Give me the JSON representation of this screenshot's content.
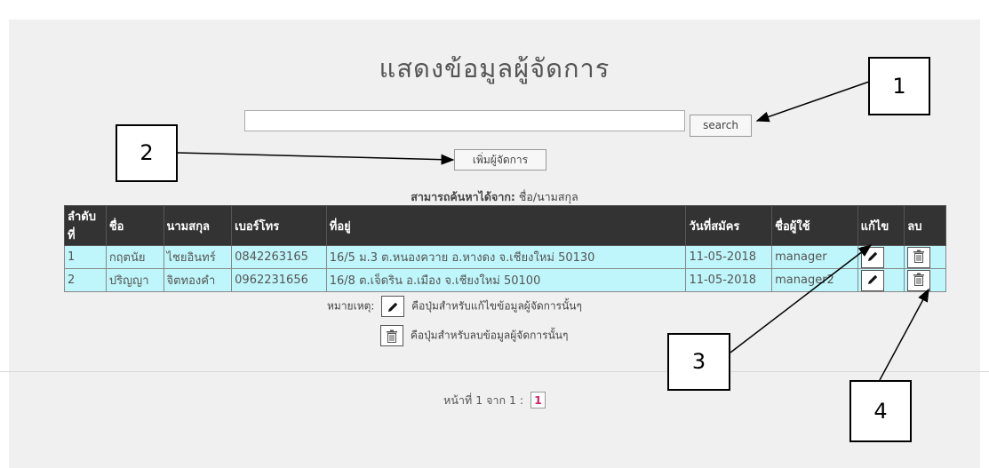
{
  "page": {
    "title": "แสดงข้อมูลผู้จัดการ",
    "search": {
      "value": "",
      "button_label": "search"
    },
    "add_button_label": "เพิ่มผู้จัดการ",
    "hint_prefix": "สามารถค้นหาได้จาก:",
    "hint_value": "ชื่อ/นามสกุล"
  },
  "table": {
    "headers": [
      "ลำดับที่",
      "ชื่อ",
      "นามสกุล",
      "เบอร์โทร",
      "ที่อยู่",
      "วันที่สมัคร",
      "ชื่อผู้ใช้",
      "แก้ไข",
      "ลบ"
    ],
    "rows": [
      {
        "no": "1",
        "first": "กฤตนัย",
        "last": "ไชยอินทร์",
        "phone": "0842263165",
        "address": "16/5 ม.3 ต.หนองควาย อ.หางดง จ.เชียงใหม่ 50130",
        "date": "11-05-2018",
        "username": "manager"
      },
      {
        "no": "2",
        "first": "ปริญญา",
        "last": "จิตทองคำ",
        "phone": "0962231656",
        "address": "16/8 ต.เจ็ดริน อ.เมือง จ.เชียงใหม่ 50100",
        "date": "11-05-2018",
        "username": "manager2"
      }
    ]
  },
  "notes": {
    "prefix": "หมายเหตุ:",
    "edit_note": "คือปุ่มสำหรับแก้ไขข้อมูลผู้จัดการนั้นๆ",
    "delete_note": "คือปุ่มสำหรับลบข้อมูลผู้จัดการนั้นๆ"
  },
  "pager": {
    "label": "หน้าที่ 1 จาก 1 :",
    "current": "1"
  },
  "callouts": [
    "1",
    "2",
    "3",
    "4"
  ],
  "icons": {
    "edit": "pencil-icon",
    "delete": "trash-icon"
  },
  "colors": {
    "header_bg": "#333333",
    "row_bg": "#bff6fb",
    "page_link": "#d6246e"
  }
}
